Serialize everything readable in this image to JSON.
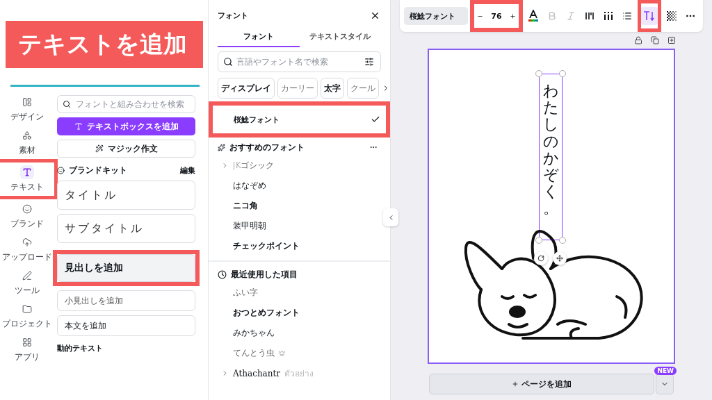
{
  "callout": {
    "text": "テキストを追加"
  },
  "rail": [
    {
      "label": "デザイン",
      "kind": "design",
      "selected": false,
      "highlighted": false
    },
    {
      "label": "素材",
      "kind": "elements",
      "selected": false,
      "highlighted": false
    },
    {
      "label": "テキスト",
      "kind": "text",
      "selected": true,
      "highlighted": true
    },
    {
      "label": "ブランド",
      "kind": "brand",
      "selected": false,
      "highlighted": false
    },
    {
      "label": "アップロード",
      "kind": "upload",
      "selected": false,
      "highlighted": false
    },
    {
      "label": "ツール",
      "kind": "tools",
      "selected": false,
      "highlighted": false
    },
    {
      "label": "プロジェクト",
      "kind": "projects",
      "selected": false,
      "highlighted": false
    },
    {
      "label": "アプリ",
      "kind": "apps",
      "selected": false,
      "highlighted": false
    }
  ],
  "text_panel": {
    "search": {
      "placeholder": "フォントと組み合わせを検索"
    },
    "add_textbox": "テキストボックスを追加",
    "magic_write": "マジック作文",
    "brand_kit": {
      "title": "ブランドキット",
      "action": "編集",
      "items": [
        {
          "label": "タイトル"
        },
        {
          "label": "サブタイトル"
        }
      ]
    },
    "styles": [
      {
        "label": "見出しを追加",
        "kind": "heading",
        "highlighted": true
      },
      {
        "label": "小見出しを追加",
        "kind": "subheading",
        "highlighted": false
      },
      {
        "label": "本文を追加",
        "kind": "body",
        "highlighted": false
      }
    ],
    "dynamic_heading": "動的テキスト"
  },
  "font_panel": {
    "title": "フォント",
    "tabs": [
      {
        "label": "フォント",
        "selected": true
      },
      {
        "label": "テキストスタイル",
        "selected": false
      }
    ],
    "search": {
      "placeholder": "言語やフォント名で検索"
    },
    "chips": [
      {
        "label": "ディスプレイ",
        "kind": "heavy"
      },
      {
        "label": "カーリー",
        "kind": "light"
      },
      {
        "label": "太字",
        "kind": "heavy"
      },
      {
        "label": "クール",
        "kind": "light"
      }
    ],
    "current": [
      {
        "label": "桜鯰フォント",
        "checked": true,
        "highlighted": true
      }
    ],
    "recommended": {
      "title": "おすすめのフォント",
      "items": [
        {
          "label": "JKゴシック",
          "kind": "light",
          "expandable": true,
          "premium": false
        },
        {
          "label": "はなぞめ",
          "kind": "regular",
          "expandable": false,
          "premium": false
        },
        {
          "label": "ニコ角",
          "kind": "bold",
          "expandable": false,
          "premium": false
        },
        {
          "label": "装甲明朝",
          "kind": "serif",
          "expandable": false,
          "premium": false
        },
        {
          "label": "チェックポイント",
          "kind": "heavy",
          "expandable": false,
          "premium": false
        }
      ]
    },
    "recent": {
      "title": "最近使用した項目",
      "items": [
        {
          "label": "ふい字",
          "kind": "light",
          "expandable": false,
          "premium": false
        },
        {
          "label": "おつとめフォント",
          "kind": "heavy",
          "expandable": false,
          "premium": false
        },
        {
          "label": "みかちゃん",
          "kind": "regular",
          "expandable": false,
          "premium": false
        },
        {
          "label": "てんとう虫",
          "kind": "light",
          "expandable": false,
          "premium": true
        },
        {
          "label": "Athachantr",
          "kind": "serif",
          "expandable": true,
          "premium": false,
          "sample": "ตัวอย่าง"
        }
      ]
    }
  },
  "toolbar": {
    "font": "桜鯰フォント",
    "size": {
      "value": "76",
      "highlighted": true
    },
    "tools": [
      {
        "kind": "color",
        "selected": false,
        "disabled": false,
        "highlighted": false
      },
      {
        "kind": "bold",
        "selected": false,
        "disabled": true,
        "highlighted": false
      },
      {
        "kind": "italic",
        "selected": false,
        "disabled": true,
        "highlighted": false
      },
      {
        "kind": "letter-spacing",
        "selected": false,
        "disabled": false,
        "highlighted": false
      },
      {
        "kind": "line-spacing",
        "selected": false,
        "disabled": false,
        "highlighted": false
      },
      {
        "kind": "list",
        "selected": false,
        "disabled": false,
        "highlighted": false
      },
      {
        "kind": "vertical-text",
        "selected": true,
        "disabled": false,
        "highlighted": true
      },
      {
        "kind": "transparency",
        "selected": false,
        "disabled": false,
        "highlighted": false
      },
      {
        "kind": "more",
        "selected": false,
        "disabled": false,
        "highlighted": false
      }
    ]
  },
  "canvas": {
    "text": "わたしのかぞく。",
    "selected": true
  },
  "add_page": {
    "label": "ページを追加",
    "badge": "NEW"
  }
}
